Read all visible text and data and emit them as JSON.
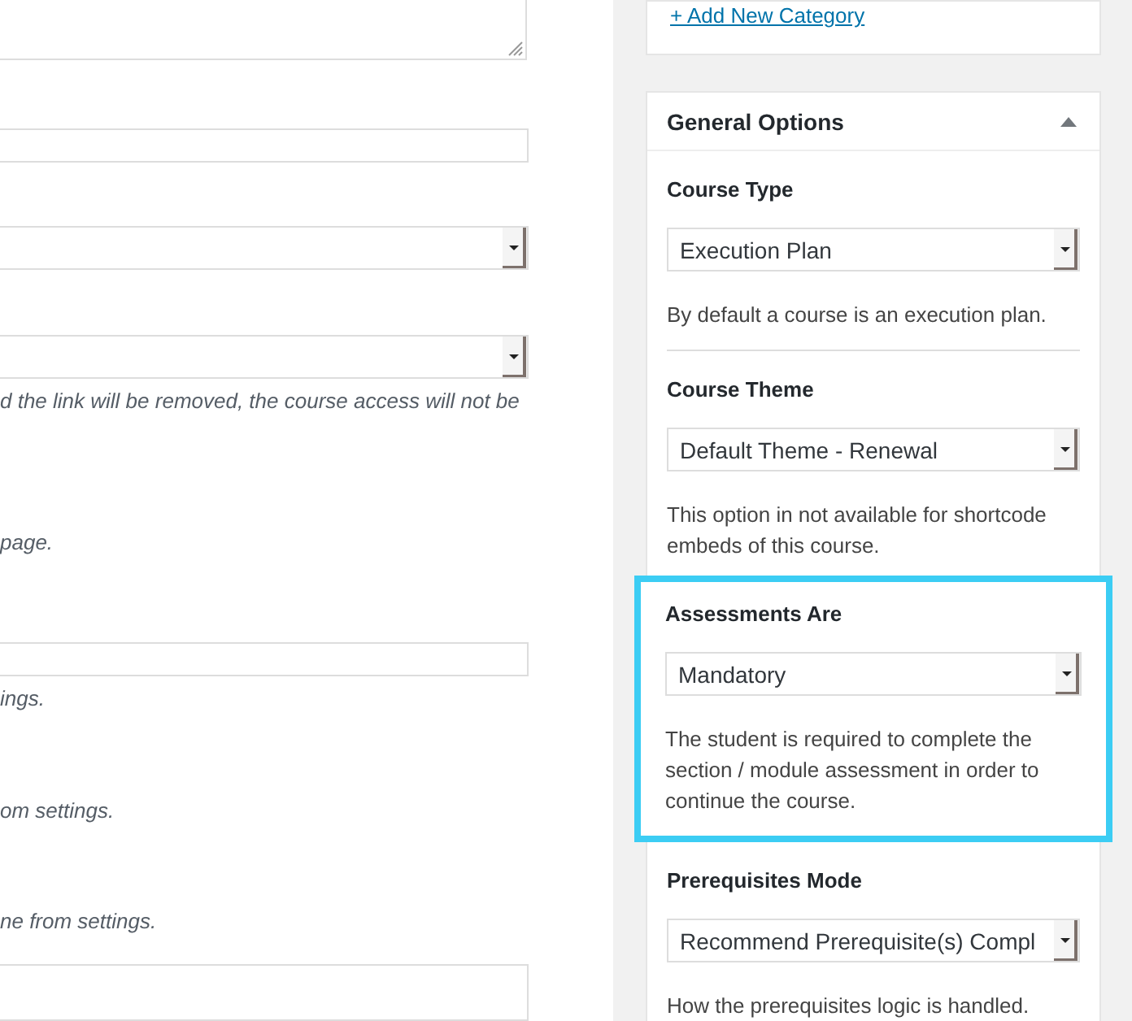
{
  "main_form": {
    "items": [
      {
        "kind": "textarea"
      },
      {
        "kind": "input"
      },
      {
        "kind": "select"
      },
      {
        "kind": "select"
      },
      {
        "kind": "note",
        "text": "d the link will be removed, the course access will not be"
      },
      {
        "kind": "note",
        "text": "page."
      },
      {
        "kind": "input"
      },
      {
        "kind": "note",
        "text": "ings."
      },
      {
        "kind": "note",
        "text": "om settings."
      },
      {
        "kind": "note",
        "text": "ne from settings."
      },
      {
        "kind": "input"
      }
    ]
  },
  "category_box": {
    "link": "+ Add New Category"
  },
  "general_options": {
    "title": "General Options",
    "expanded": true,
    "sections": [
      {
        "label": "Course Type",
        "value": "Execution Plan",
        "hint": "By default a course is an execution plan.",
        "highlighted": false
      },
      {
        "label": "Course Theme",
        "value": "Default Theme - Renewal",
        "hint": "This option in not available for shortcode embeds of this course.",
        "highlighted": false
      },
      {
        "label": "Assessments Are",
        "value": "Mandatory",
        "hint": "The student is required to complete the section / module assessment in order to continue the course.",
        "highlighted": true
      },
      {
        "label": "Prerequisites Mode",
        "value": "Recommend Prerequisite(s) Compl",
        "hint": "How the prerequisites logic is handled.",
        "highlighted": false
      }
    ]
  }
}
